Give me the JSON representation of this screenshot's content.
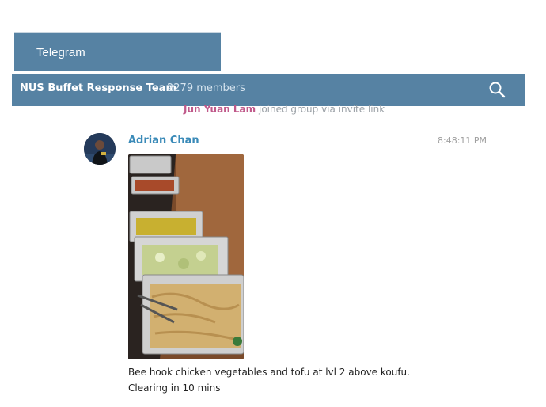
{
  "app": {
    "title": "Telegram"
  },
  "header": {
    "chat_name": "NUS Buffet Response Team",
    "members": "2279 members"
  },
  "service": {
    "user": "Jun Yuan Lam",
    "action": "joined group via invite link"
  },
  "message": {
    "author": "Adrian Chan",
    "time": "8:48:11 PM",
    "caption_line1": "Bee hook chicken vegetables and tofu at lvl 2 above koufu.",
    "caption_line2": "Clearing in 10 mins"
  },
  "colors": {
    "header_bg": "#5682a3",
    "author": "#3a8ab8",
    "service_user": "#c0598a"
  },
  "icons": {
    "search": "search-icon"
  }
}
